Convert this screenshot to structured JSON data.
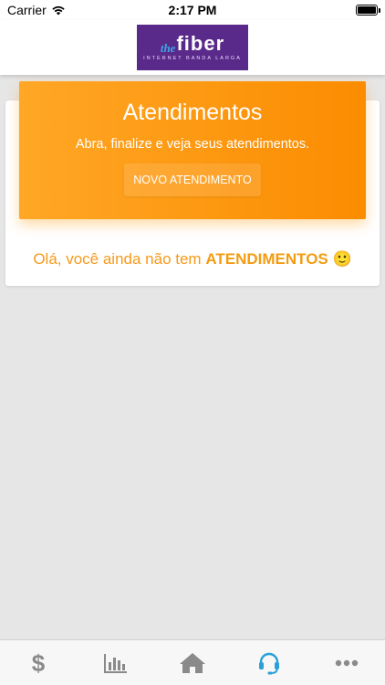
{
  "status_bar": {
    "carrier": "Carrier",
    "time": "2:17 PM"
  },
  "header": {
    "logo_the": "the",
    "logo_fiber": "fiber",
    "logo_tagline": "INTERNET BANDA LARGA"
  },
  "hero": {
    "title": "Atendimentos",
    "subtitle": "Abra, finalize e veja seus atendimentos.",
    "button_label": "NOVO ATENDIMENTO"
  },
  "empty_state": {
    "prefix": "Olá, você ainda não tem ",
    "highlight": "ATENDIMENTOS",
    "emoji": "🙂"
  },
  "tabbar": {
    "items": [
      {
        "icon": "dollar-icon",
        "active": false
      },
      {
        "icon": "bar-chart-icon",
        "active": false
      },
      {
        "icon": "home-icon",
        "active": false
      },
      {
        "icon": "headset-icon",
        "active": true
      },
      {
        "icon": "more-icon",
        "active": false
      }
    ]
  },
  "colors": {
    "accent_orange": "#fb8c00",
    "brand_purple": "#5a2a8a",
    "active_tab": "#2aa0d6",
    "inactive_tab": "#8a8a8a"
  }
}
